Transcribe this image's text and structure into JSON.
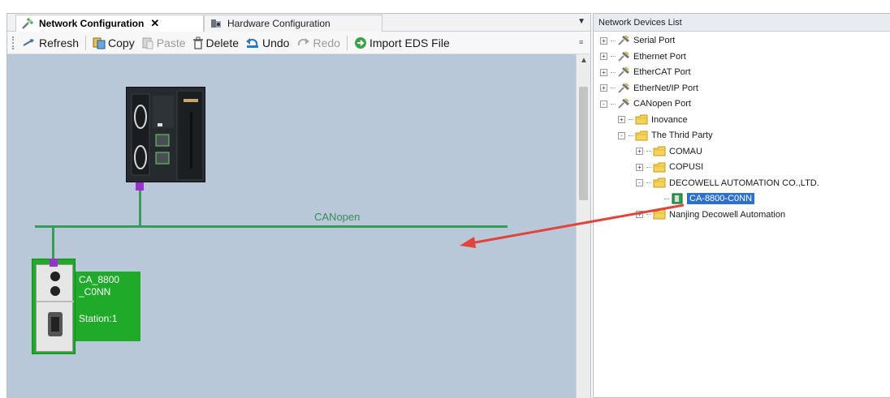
{
  "tabs": [
    {
      "label": "Network Configuration",
      "active": true,
      "icon": "network-config-icon"
    },
    {
      "label": "Hardware Configuration",
      "active": false,
      "icon": "hardware-config-icon"
    }
  ],
  "toolbar": {
    "refresh": "Refresh",
    "copy": "Copy",
    "paste": "Paste",
    "delete": "Delete",
    "undo": "Undo",
    "redo": "Redo",
    "import_eds": "Import EDS File"
  },
  "canvas": {
    "bus_label": "CANopen",
    "device_name": "CA_8800\n_C0NN",
    "device_station": "Station:1",
    "bus_color": "#3a9a5a",
    "port_color": "#9b30d0",
    "device_color": "#1faa2a",
    "arrow_color": "#e0443a"
  },
  "devices_panel": {
    "title": "Network Devices List",
    "items": [
      {
        "label": "Serial Port",
        "level": 0,
        "expander": "+",
        "icon": "port-icon"
      },
      {
        "label": "Ethernet Port",
        "level": 0,
        "expander": "+",
        "icon": "port-icon"
      },
      {
        "label": "EtherCAT Port",
        "level": 0,
        "expander": "+",
        "icon": "port-icon"
      },
      {
        "label": "EtherNet/IP Port",
        "level": 0,
        "expander": "+",
        "icon": "port-icon"
      },
      {
        "label": "CANopen Port",
        "level": 0,
        "expander": "-",
        "icon": "port-icon"
      },
      {
        "label": "Inovance",
        "level": 1,
        "expander": "+",
        "icon": "folder-icon"
      },
      {
        "label": "The Thrid Party",
        "level": 1,
        "expander": "-",
        "icon": "folder-open-icon"
      },
      {
        "label": "COMAU",
        "level": 2,
        "expander": "+",
        "icon": "folder-icon"
      },
      {
        "label": "COPUSI",
        "level": 2,
        "expander": "+",
        "icon": "folder-icon"
      },
      {
        "label": "DECOWELL AUTOMATION CO.,LTD.",
        "level": 2,
        "expander": "-",
        "icon": "folder-open-icon"
      },
      {
        "label": "CA-8800-C0NN",
        "level": 3,
        "expander": "",
        "icon": "device-icon",
        "selected": true
      },
      {
        "label": "Nanjing Decowell Automation",
        "level": 2,
        "expander": "+",
        "icon": "folder-icon"
      }
    ]
  }
}
